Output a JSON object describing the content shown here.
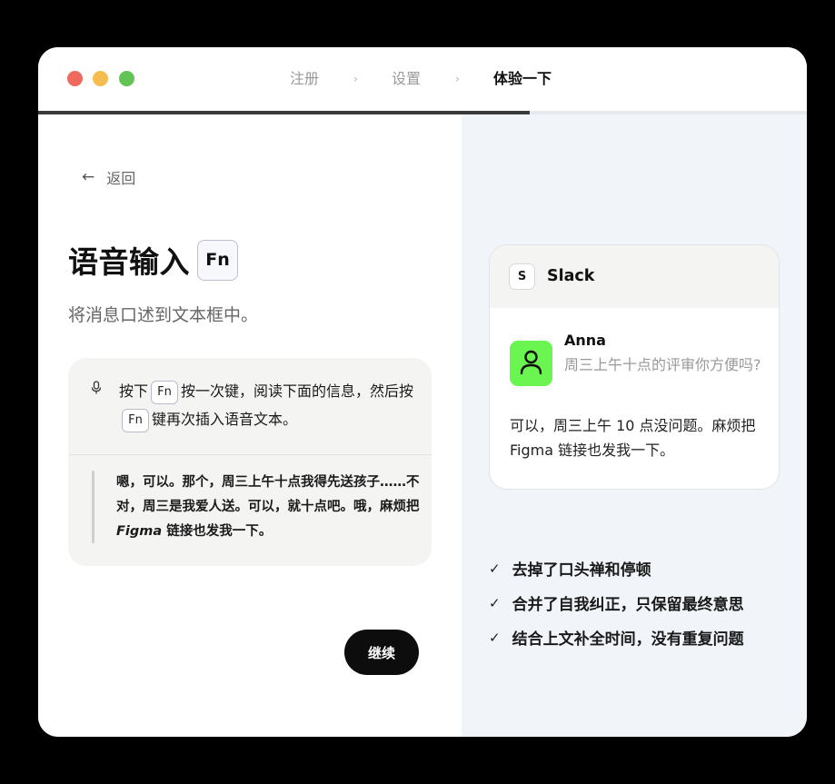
{
  "steps": [
    {
      "label": "注册"
    },
    {
      "label": "设置"
    },
    {
      "label": "体验一下"
    }
  ],
  "step_separator": "›",
  "progress": 0.64,
  "back_label": "返回",
  "heading": "语音输入",
  "heading_key": "Fn",
  "subtitle": "将消息口述到文本框中。",
  "instruction": {
    "t1": "按下",
    "key1": "Fn",
    "t2": "按一次键，阅读下面的信息，然后按",
    "key2": "Fn",
    "t3": "键再次插入语音文本。"
  },
  "quote": {
    "before": "嗯，可以。那个，周三上午十点我得先送孩子……不对，周三是我爱人送。可以，就十点吧。哦，麻烦把 ",
    "emph": "Figma",
    "after": " 链接也发我一下。"
  },
  "continue_label": "继续",
  "slack": {
    "logo": "S",
    "app_name": "Slack",
    "sender": "Anna",
    "message": "周三上午十点的评审你方便吗?",
    "reply": "可以，周三上午 10 点没问题。麻烦把 Figma 链接也发我一下。"
  },
  "checks": [
    "去掉了口头禅和停顿",
    "合并了自我纠正，只保留最终意思",
    "结合上文补全时间，没有重复问题"
  ],
  "colors": {
    "accent_green": "#6bf551",
    "right_panel_bg": "#f1f4f8",
    "traffic_red": "#ee6a5f",
    "traffic_yellow": "#f5bd4f",
    "traffic_green": "#61c454"
  }
}
